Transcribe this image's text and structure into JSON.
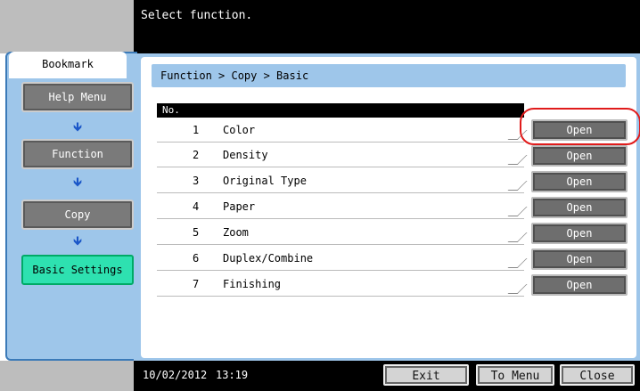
{
  "header": {
    "message": "Select function."
  },
  "sidebar": {
    "tab_label": "Bookmark",
    "items": [
      {
        "label": "Help Menu"
      },
      {
        "label": "Function"
      },
      {
        "label": "Copy"
      },
      {
        "label": "Basic Settings"
      }
    ]
  },
  "main": {
    "breadcrumb": "Function > Copy > Basic",
    "table_header": "No.",
    "rows": [
      {
        "no": "1",
        "name": "Color",
        "action": "Open"
      },
      {
        "no": "2",
        "name": "Density",
        "action": "Open"
      },
      {
        "no": "3",
        "name": "Original Type",
        "action": "Open"
      },
      {
        "no": "4",
        "name": "Paper",
        "action": "Open"
      },
      {
        "no": "5",
        "name": "Zoom",
        "action": "Open"
      },
      {
        "no": "6",
        "name": "Duplex/Combine",
        "action": "Open"
      },
      {
        "no": "7",
        "name": "Finishing",
        "action": "Open"
      }
    ]
  },
  "footer": {
    "date": "10/02/2012",
    "time": "13:19",
    "exit_label": "Exit",
    "to_menu_label": "To Menu",
    "close_label": "Close"
  },
  "colors": {
    "panel_blue": "#9ec6ea",
    "active_green": "#2ee1b0",
    "highlight_red": "#e01b1b",
    "arrow_blue": "#1a56c8"
  }
}
